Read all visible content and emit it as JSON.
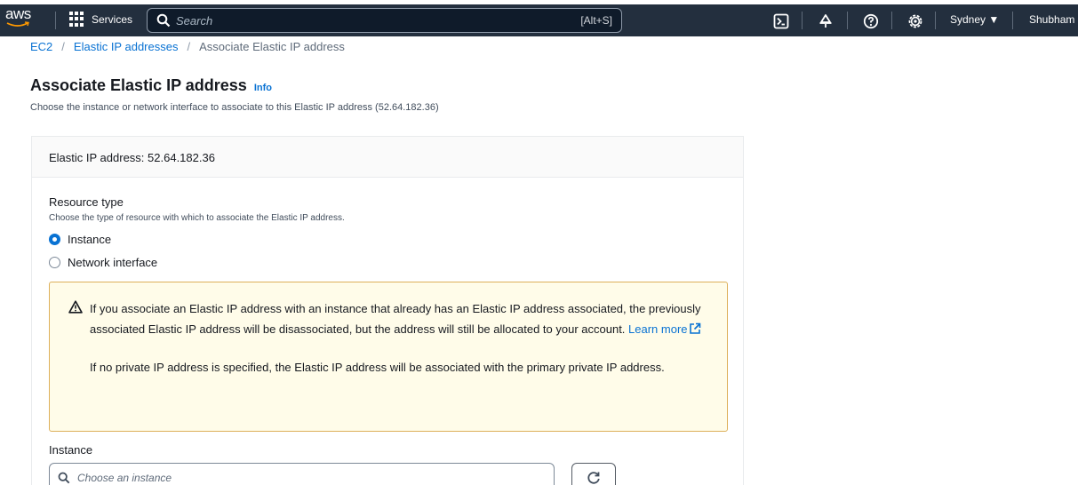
{
  "nav": {
    "logo_text": "aws",
    "services_label": "Services",
    "search_placeholder": "Search",
    "search_shortcut": "[Alt+S]",
    "region_label": "Sydney ▼",
    "user_label": "Shubham"
  },
  "breadcrumb": [
    "EC2",
    "Elastic IP addresses",
    "Associate Elastic IP address"
  ],
  "page": {
    "title": "Associate Elastic IP address",
    "info_link": "Info",
    "subtitle": "Choose the instance or network interface to associate to this Elastic IP address (52.64.182.36)"
  },
  "panel": {
    "header": "Elastic IP address: 52.64.182.36",
    "resource_type_label": "Resource type",
    "resource_type_desc": "Choose the type of resource with which to associate the Elastic IP address.",
    "options": [
      {
        "label": "Instance",
        "checked": true
      },
      {
        "label": "Network interface",
        "checked": false
      }
    ],
    "alert": {
      "para1": "If you associate an Elastic IP address with an instance that already has an Elastic IP address associated, the previously associated Elastic IP address will be disassociated, but the address will still be allocated to your account. ",
      "learn_more": "Learn more",
      "para2": "If no private IP address is specified, the Elastic IP address will be associated with the primary private IP address."
    },
    "instance_label": "Instance",
    "instance_placeholder": "Choose an instance"
  },
  "colors": {
    "nav_bg": "#232f3e",
    "link": "#0972d3",
    "warning_bg": "#fffce9",
    "warning_border": "#ddb05a"
  }
}
